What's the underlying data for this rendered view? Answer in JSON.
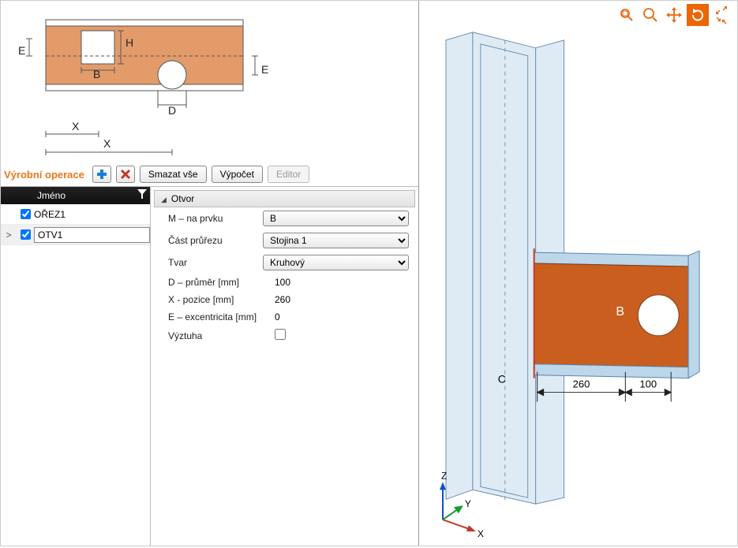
{
  "toolbar": {
    "section_title": "Výrobní operace",
    "delete_all_label": "Smazat vše",
    "calculate_label": "Výpočet",
    "editor_label": "Editor"
  },
  "list": {
    "header": "Jméno",
    "rows": [
      {
        "name": "OŘEZ1",
        "checked": true,
        "selected": false
      },
      {
        "name": "OTV1",
        "checked": true,
        "selected": true
      }
    ]
  },
  "props": {
    "group_title": "Otvor",
    "items": [
      {
        "label": "M – na prvku",
        "type": "select",
        "value": "B"
      },
      {
        "label": "Část průřezu",
        "type": "select",
        "value": "Stojina 1"
      },
      {
        "label": "Tvar",
        "type": "select",
        "value": "Kruhový"
      },
      {
        "label": "D – průměr [mm]",
        "type": "text",
        "value": "100"
      },
      {
        "label": "X - pozice [mm]",
        "type": "text",
        "value": "260"
      },
      {
        "label": "E – excentricita [mm]",
        "type": "text",
        "value": "0"
      },
      {
        "label": "Výztuha",
        "type": "checkbox",
        "value": false
      }
    ]
  },
  "schematic": {
    "labels": {
      "E": "E",
      "H": "H",
      "B": "B",
      "D": "D",
      "X": "X"
    }
  },
  "view3d": {
    "labels": {
      "B": "B",
      "C": "C",
      "X": "X",
      "Y": "Y",
      "Z": "Z"
    },
    "dims": {
      "d260": "260",
      "d100": "100"
    }
  }
}
